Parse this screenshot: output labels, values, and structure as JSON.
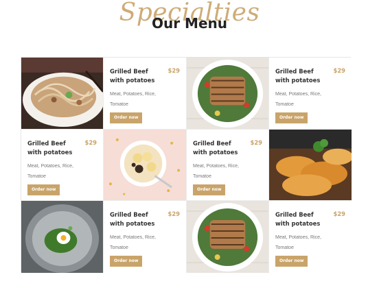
{
  "heading": {
    "script_title": "Specialties",
    "title": "Our Menu"
  },
  "menu": {
    "items": [
      {
        "name": "Grilled Beef with potatoes",
        "price": "$29",
        "description": "Meat, Potatoes, Rice, Tomatoe",
        "button": "Order now"
      },
      {
        "name": "Grilled Beef with potatoes",
        "price": "$29",
        "description": "Meat, Potatoes, Rice, Tomatoe",
        "button": "Order now"
      },
      {
        "name": "Grilled Beef with potatoes",
        "price": "$29",
        "description": "Meat, Potatoes, Rice, Tomatoe",
        "button": "Order now"
      },
      {
        "name": "Grilled Beef with potatoes",
        "price": "$29",
        "description": "Meat, Potatoes, Rice, Tomatoe",
        "button": "Order now"
      },
      {
        "name": "Grilled Beef with potatoes",
        "price": "$29",
        "description": "Meat, Potatoes, Rice, Tomatoe",
        "button": "Order now"
      },
      {
        "name": "Grilled Beef with potatoes",
        "price": "$29",
        "description": "Meat, Potatoes, Rice, Tomatoe",
        "button": "Order now"
      }
    ],
    "images": [
      {
        "icon": "noodles-dish-photo"
      },
      {
        "icon": "grilled-salad-photo"
      },
      {
        "icon": "granola-bowl-photo"
      },
      {
        "icon": "fried-chicken-photo"
      },
      {
        "icon": "avocado-egg-plate-photo"
      },
      {
        "icon": "grilled-salad-photo"
      }
    ]
  },
  "colors": {
    "accent": "#c9a46a",
    "title": "#222222",
    "text_muted": "#777777"
  }
}
